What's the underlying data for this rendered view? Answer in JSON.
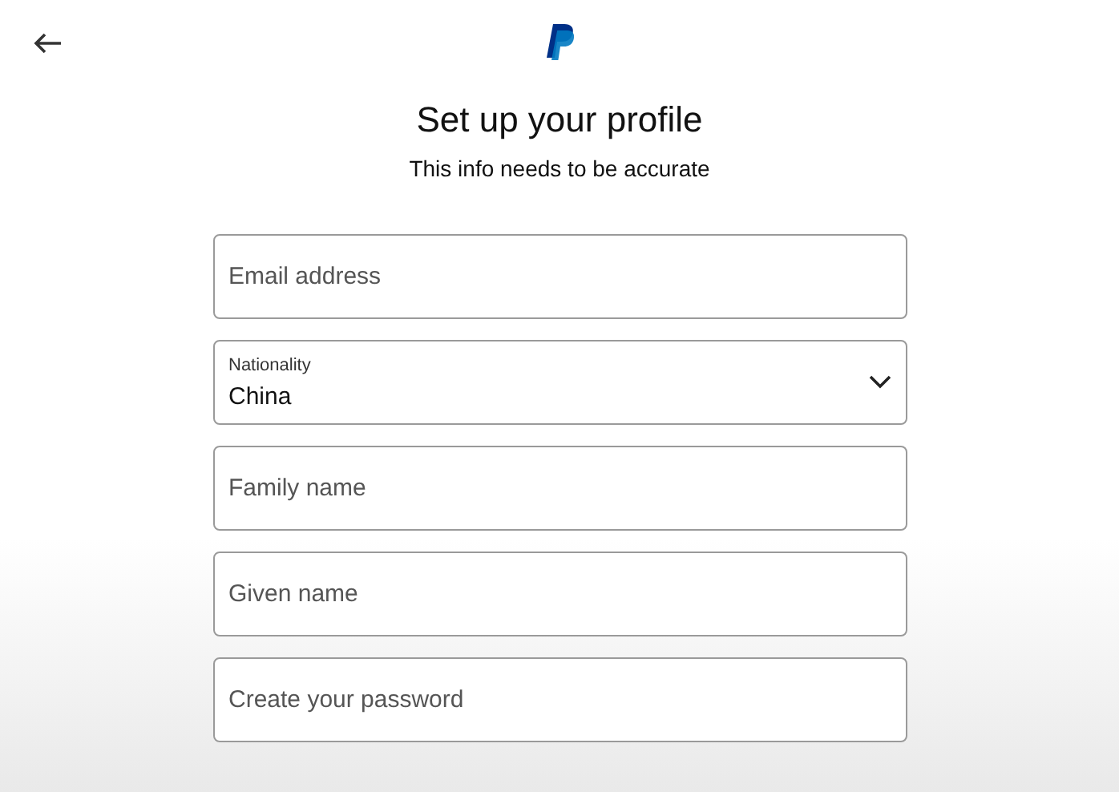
{
  "title": "Set up your profile",
  "subtitle": "This info needs to be accurate",
  "fields": [
    {
      "kind": "text",
      "placeholder": "Email address"
    },
    {
      "kind": "select",
      "label": "Nationality",
      "value": "China"
    },
    {
      "kind": "text",
      "placeholder": "Family name"
    },
    {
      "kind": "text",
      "placeholder": "Given name"
    },
    {
      "kind": "text",
      "placeholder": "Create your password"
    }
  ]
}
